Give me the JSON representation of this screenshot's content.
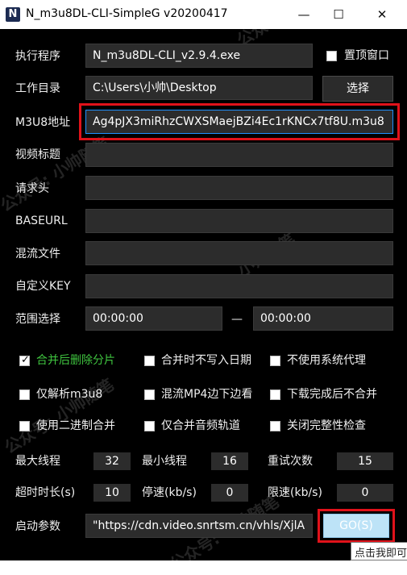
{
  "window": {
    "icon_letter": "N",
    "title": "N_m3u8DL-CLI-SimpleG v20200417",
    "minimize_glyph": "—",
    "maximize_glyph": "☐",
    "close_glyph": "✕"
  },
  "rows": {
    "exe": {
      "label": "执行程序",
      "value": "N_m3u8DL-CLI_v2.9.4.exe"
    },
    "workdir": {
      "label": "工作目录",
      "value": "C:\\Users\\小帅\\Desktop"
    },
    "m3u8": {
      "label": "M3U8地址",
      "value": "Ag4pJX3miRhzCWXSMaejBZi4Ec1rKNCx7tf8U.m3u8"
    },
    "title": {
      "label": "视频标题",
      "value": ""
    },
    "headers": {
      "label": "请求头",
      "value": ""
    },
    "baseurl": {
      "label": "BASEURL",
      "value": ""
    },
    "mux": {
      "label": "混流文件",
      "value": ""
    },
    "key": {
      "label": "自定义KEY",
      "value": ""
    },
    "range": {
      "label": "范围选择",
      "start": "00:00:00",
      "separator": "—",
      "end": "00:00:00"
    }
  },
  "buttons": {
    "pin_label": "置顶窗口",
    "select_label": "选择",
    "go_label": "GO(S)"
  },
  "checkboxes": [
    {
      "label": "合并后删除分片",
      "checked": true
    },
    {
      "label": "合并时不写入日期",
      "checked": false
    },
    {
      "label": "不使用系统代理",
      "checked": false
    },
    {
      "label": "仅解析m3u8",
      "checked": false
    },
    {
      "label": "混流MP4边下边看",
      "checked": false
    },
    {
      "label": "下载完成后不合并",
      "checked": false
    },
    {
      "label": "使用二进制合并",
      "checked": false
    },
    {
      "label": "仅合并音频轨道",
      "checked": false
    },
    {
      "label": "关闭完整性检查",
      "checked": false
    }
  ],
  "settings": {
    "max_threads": {
      "label": "最大线程",
      "value": "32"
    },
    "min_threads": {
      "label": "最小线程",
      "value": "16"
    },
    "retries": {
      "label": "重试次数",
      "value": "15"
    },
    "timeout": {
      "label": "超时时长(s)",
      "value": "10"
    },
    "stop_speed": {
      "label": "停速(kb/s)",
      "value": "0"
    },
    "limit_speed": {
      "label": "限速(kb/s)",
      "value": "0"
    }
  },
  "launch": {
    "label": "启动参数",
    "value": "\"https://cdn.video.snrtsm.cn/vhls/XjlA"
  },
  "tooltip": "点击我即可",
  "watermarks": [
    "公众号:",
    "公众号: 小帅随笔",
    "小帅随笔",
    "公众号: 小帅随笔",
    "公众号: 小帅随笔"
  ],
  "colors": {
    "background": "#000000",
    "field": "#2c2c2c",
    "highlight_border": "#e0121a",
    "go_button": "#bde3f7",
    "checked_label": "#3fc43f"
  }
}
